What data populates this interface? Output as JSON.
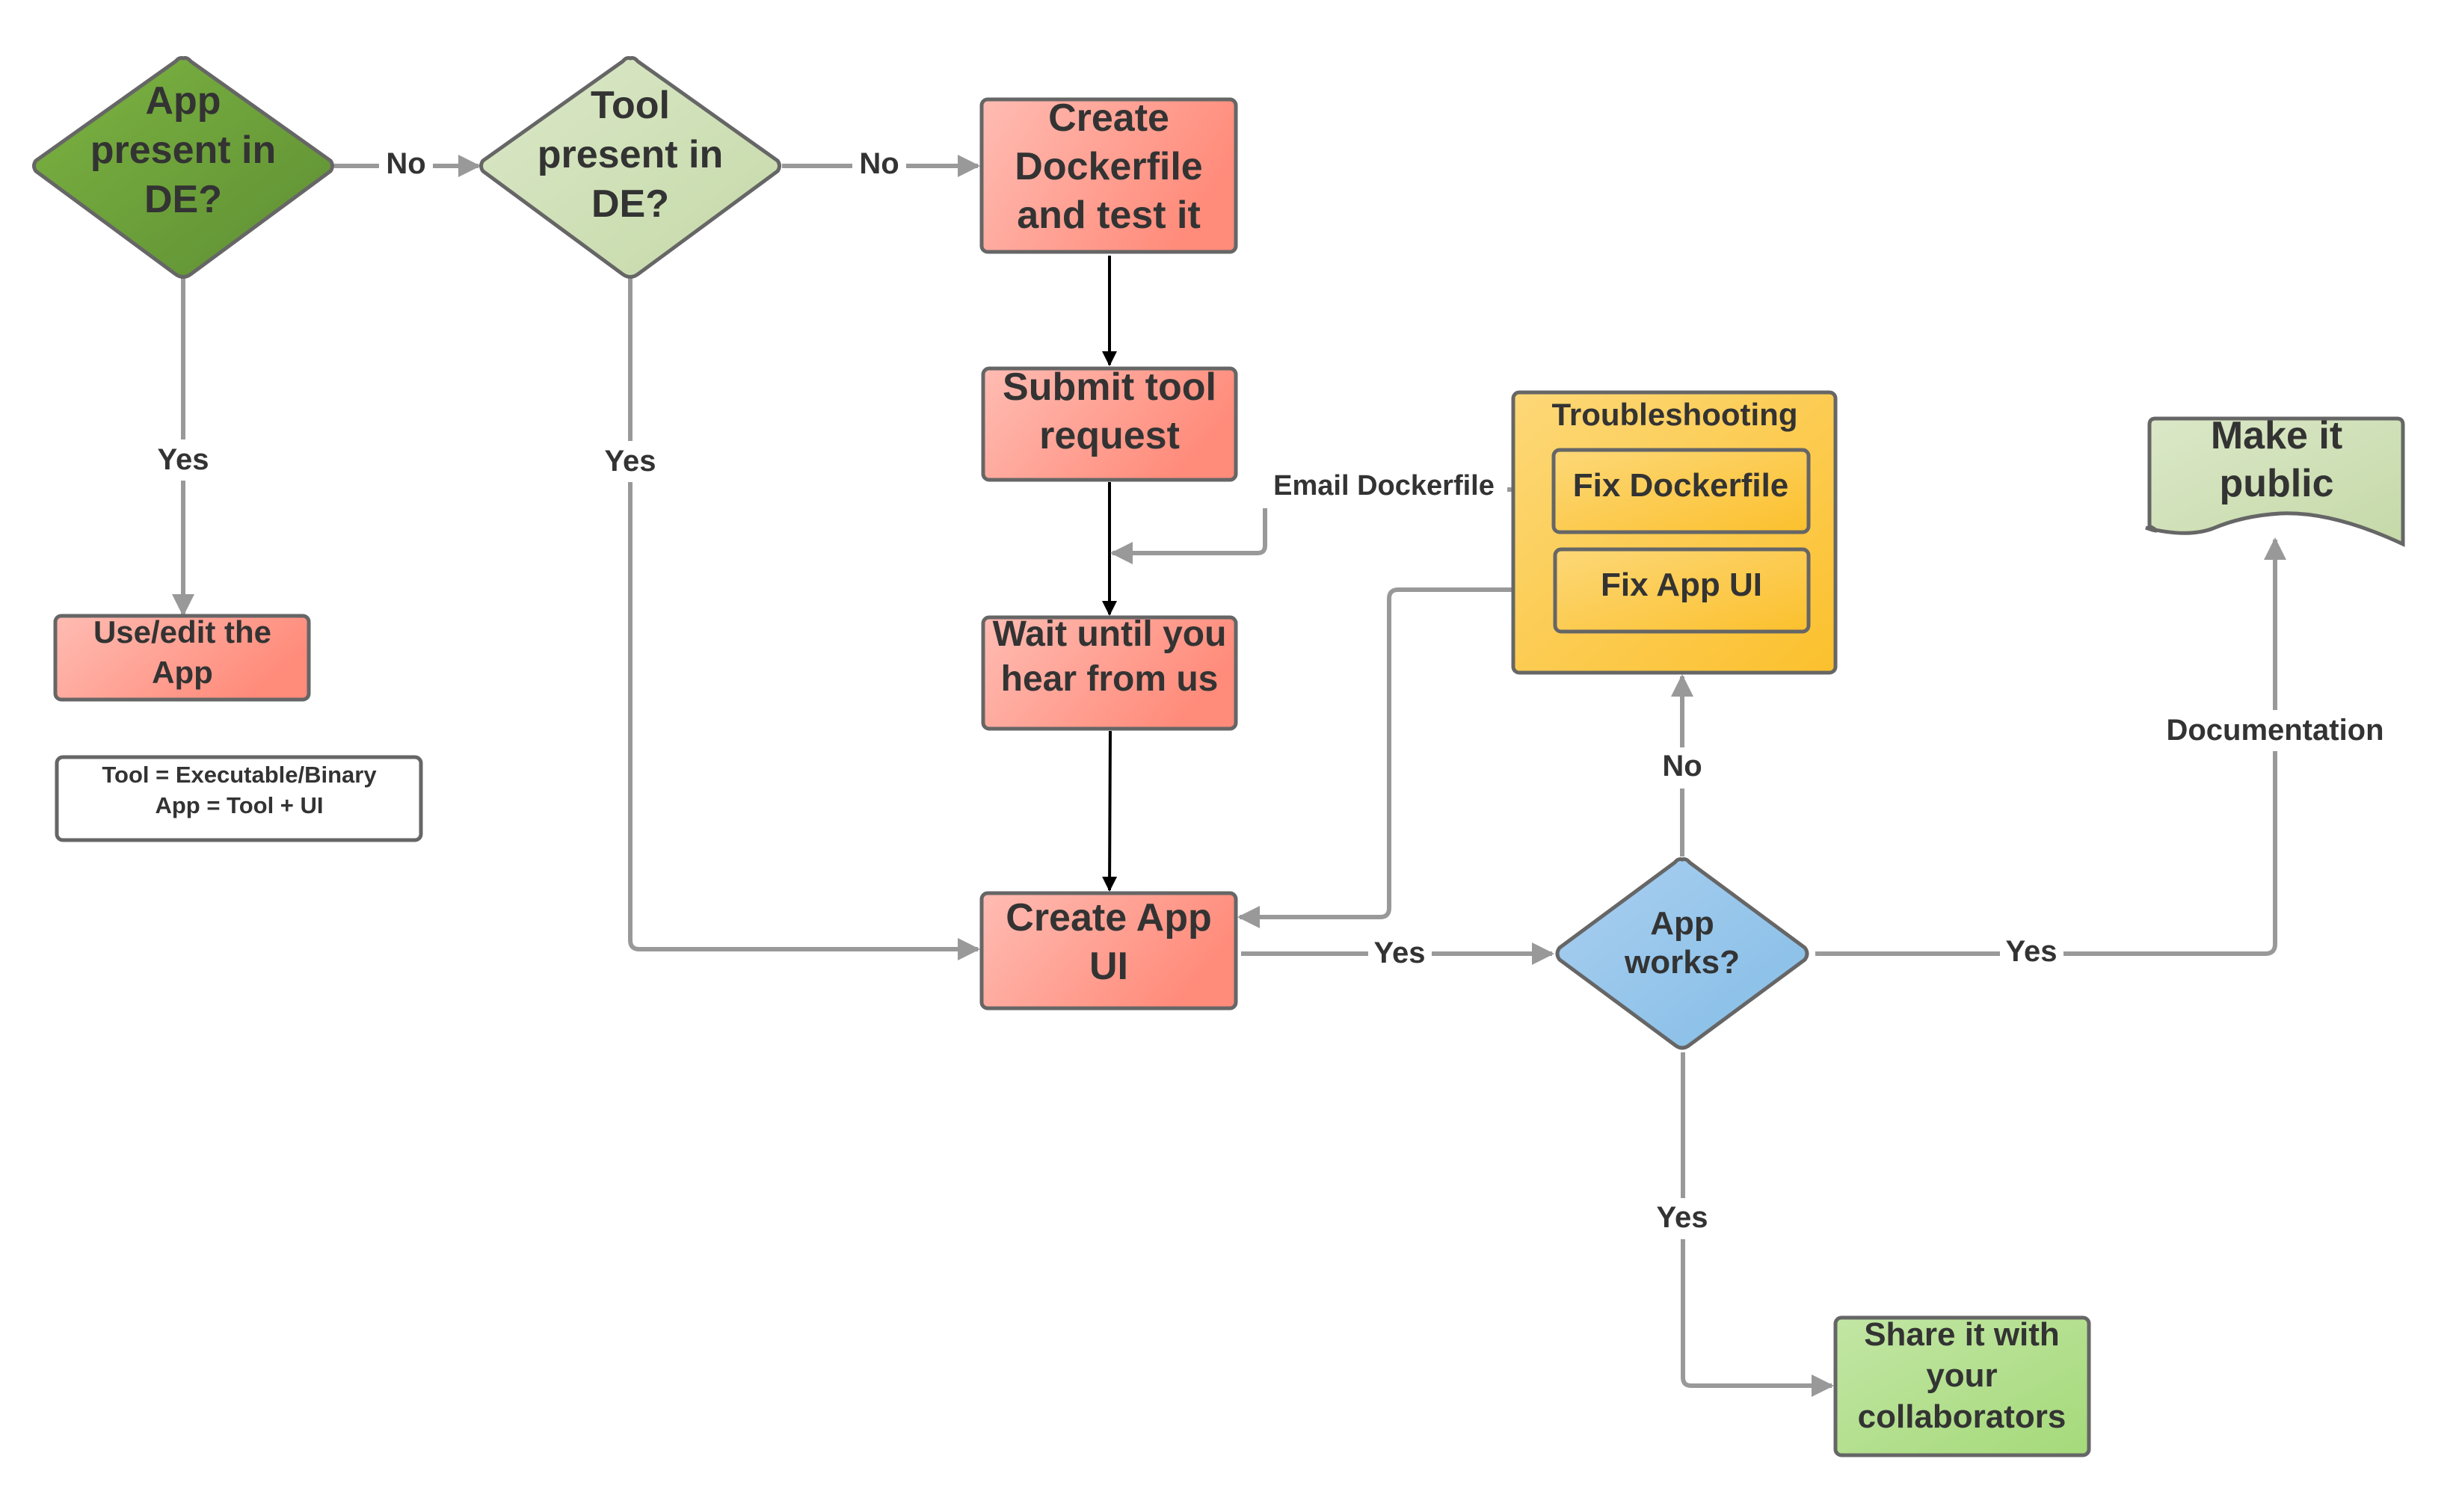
{
  "diagram": {
    "type": "flowchart",
    "nodes": {
      "app_present": {
        "shape": "diamond",
        "lines": [
          "App",
          "present in",
          "DE?"
        ],
        "fill": [
          "#7cb342",
          "#5e8f33"
        ]
      },
      "tool_present": {
        "shape": "diamond",
        "lines": [
          "Tool",
          "present in",
          "DE?"
        ],
        "fill": [
          "#dbe8c8",
          "#c5d9a8"
        ]
      },
      "create_dockerfile": {
        "shape": "process",
        "lines": [
          "Create",
          "Dockerfile",
          "and test it"
        ],
        "fill": [
          "#ffbcb3",
          "#ff8b7a"
        ]
      },
      "submit_tool_request": {
        "shape": "process",
        "lines": [
          "Submit tool",
          "request"
        ],
        "fill": [
          "#ffbcb3",
          "#ff8b7a"
        ]
      },
      "wait_until": {
        "shape": "process",
        "lines": [
          "Wait until you",
          "hear from us"
        ],
        "fill": [
          "#ffbcb3",
          "#ff8b7a"
        ]
      },
      "create_app_ui": {
        "shape": "process",
        "lines": [
          "Create App",
          "UI"
        ],
        "fill": [
          "#ffbcb3",
          "#ff8b7a"
        ]
      },
      "use_edit_app": {
        "shape": "process",
        "lines": [
          "Use/edit the",
          "App"
        ],
        "fill": [
          "#ffbcb3",
          "#ff8b7a"
        ]
      },
      "legend": {
        "shape": "note",
        "lines": [
          "Tool = Executable/Binary",
          "App = Tool + UI"
        ],
        "fill": [
          "#ffffff",
          "#ffffff"
        ]
      },
      "troubleshooting": {
        "shape": "container",
        "title": "Troubleshooting",
        "fill": [
          "#fdd878",
          "#fbc02d"
        ]
      },
      "fix_dockerfile": {
        "shape": "process",
        "lines": [
          "Fix Dockerfile"
        ],
        "fill": [
          "#fdd878",
          "#fbc02d"
        ]
      },
      "fix_app_ui": {
        "shape": "process",
        "lines": [
          "Fix App UI"
        ],
        "fill": [
          "#fdd878",
          "#fbc02d"
        ]
      },
      "app_works": {
        "shape": "diamond",
        "lines": [
          "App",
          "works?"
        ],
        "fill": [
          "#a9cff0",
          "#85bde6"
        ]
      },
      "make_public": {
        "shape": "document",
        "lines": [
          "Make it",
          "public"
        ],
        "fill": [
          "#dbe8c8",
          "#c5d9a8"
        ]
      },
      "share": {
        "shape": "process",
        "lines": [
          "Share it with",
          "your",
          "collaborators"
        ],
        "fill": [
          "#c2e6a4",
          "#a5d97a"
        ]
      }
    },
    "edges": [
      {
        "from": "app_present",
        "to": "tool_present",
        "label": "No"
      },
      {
        "from": "app_present",
        "to": "use_edit_app",
        "label": "Yes"
      },
      {
        "from": "tool_present",
        "to": "create_dockerfile",
        "label": "No"
      },
      {
        "from": "tool_present",
        "to": "create_app_ui",
        "label": "Yes"
      },
      {
        "from": "create_dockerfile",
        "to": "submit_tool_request",
        "label": ""
      },
      {
        "from": "submit_tool_request",
        "to": "wait_until",
        "label": ""
      },
      {
        "from": "fix_dockerfile",
        "to": "wait_until",
        "label": "Email Dockerfile"
      },
      {
        "from": "wait_until",
        "to": "create_app_ui",
        "label": ""
      },
      {
        "from": "fix_app_ui",
        "to": "create_app_ui",
        "label": ""
      },
      {
        "from": "create_app_ui",
        "to": "app_works",
        "label": "Yes"
      },
      {
        "from": "app_works",
        "to": "troubleshooting",
        "label": "No"
      },
      {
        "from": "app_works",
        "to": "make_public",
        "label": "Yes"
      },
      {
        "from": "make_public",
        "to": "make_public",
        "label": "Documentation"
      },
      {
        "from": "app_works",
        "to": "share",
        "label": "Yes"
      }
    ],
    "colors": {
      "connector": "#999999",
      "connector_dark": "#000000",
      "stroke": "#666666",
      "text": "#333333"
    }
  }
}
